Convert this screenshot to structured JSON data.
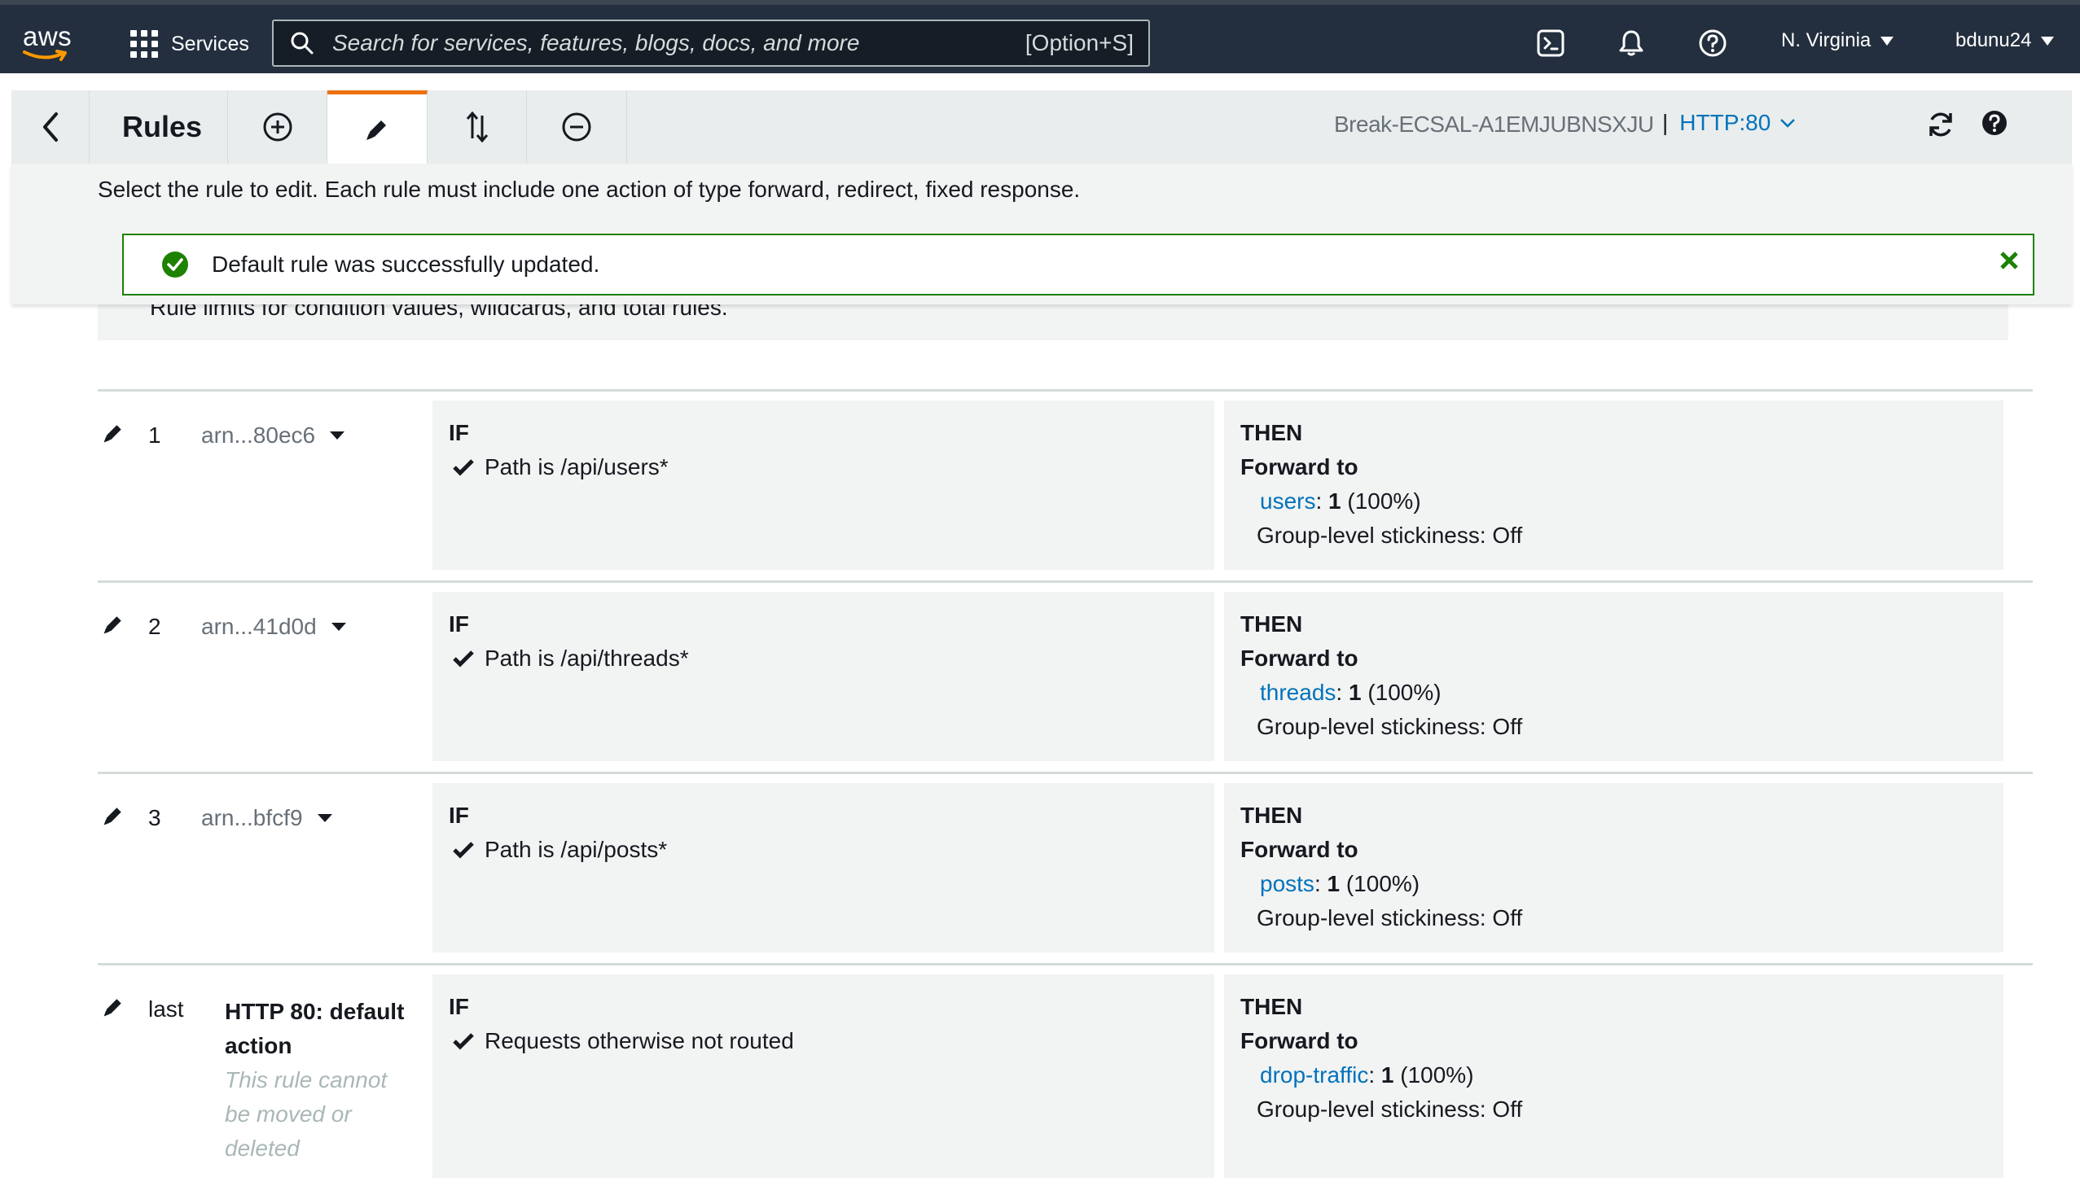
{
  "topnav": {
    "logo_text": "aws",
    "services_label": "Services",
    "search_placeholder": "Search for services, features, blogs, docs, and more",
    "search_shortcut": "[Option+S]",
    "region": "N. Virginia",
    "user": "bdunu24",
    "icons": [
      "cloudshell-icon",
      "bell-icon",
      "help-icon"
    ]
  },
  "toolbar": {
    "title": "Rules",
    "load_balancer": "Break-ECSAL-A1EMJUBNSXJU",
    "separator": "|",
    "listener": "HTTP:80",
    "buttons": [
      "back-icon",
      "add-icon",
      "edit-icon",
      "reorder-icon",
      "delete-icon",
      "refresh-icon",
      "help-icon"
    ],
    "accent_color": "#ec7211"
  },
  "panel": {
    "instruction": "Select the rule to edit. Each rule must include one action of type forward, redirect, fixed response.",
    "alert_message": "Default rule was successfully updated.",
    "limits_text": "Rule limits for condition values, wildcards, and total rules."
  },
  "rules": [
    {
      "priority": "1",
      "arn": "arn...80ec6",
      "if_label": "IF",
      "condition": "Path is /api/users*",
      "then_label": "THEN",
      "action": "Forward to",
      "target": "users",
      "weight": "1",
      "percent": "(100%)",
      "stickiness": "Group-level stickiness: Off"
    },
    {
      "priority": "2",
      "arn": "arn...41d0d",
      "if_label": "IF",
      "condition": "Path is /api/threads*",
      "then_label": "THEN",
      "action": "Forward to",
      "target": "threads",
      "weight": "1",
      "percent": "(100%)",
      "stickiness": "Group-level stickiness: Off"
    },
    {
      "priority": "3",
      "arn": "arn...bfcf9",
      "if_label": "IF",
      "condition": "Path is /api/posts*",
      "then_label": "THEN",
      "action": "Forward to",
      "target": "posts",
      "weight": "1",
      "percent": "(100%)",
      "stickiness": "Group-level stickiness: Off"
    }
  ],
  "default_rule": {
    "priority": "last",
    "name": "HTTP 80: default action",
    "note": "This rule cannot be moved or deleted",
    "if_label": "IF",
    "condition": "Requests otherwise not routed",
    "then_label": "THEN",
    "action": "Forward to",
    "target": "drop-traffic",
    "weight": "1",
    "percent": "(100%)",
    "stickiness": "Group-level stickiness: Off"
  },
  "colors": {
    "nav_bg": "#232f3e",
    "link": "#0073bb",
    "success": "#1d8102"
  }
}
